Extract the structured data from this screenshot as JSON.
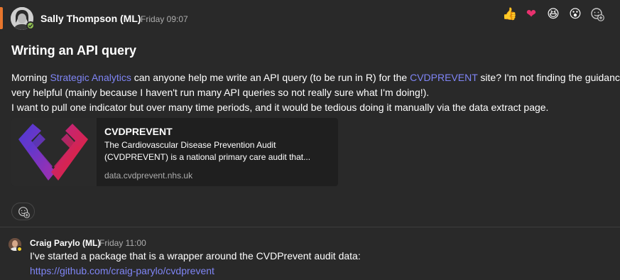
{
  "post": {
    "author": "Sally Thompson (ML)",
    "time": "Friday 09:07",
    "title": "Writing an API query",
    "body": {
      "greeting": "Morning ",
      "mention": "Strategic Analytics",
      "part1": " can anyone help me write an API query (to be run in R) for the ",
      "link": "CVDPREVENT",
      "part2": " site? I'm not finding the guidance",
      "line2": "very helpful (mainly because I haven't run many API queries so not really sure what I'm doing!).",
      "line3": "I want to pull one indicator but over many time periods, and it would be tedious doing it manually via the data extract page."
    },
    "reactions": [
      "👍",
      "❤",
      "😆",
      "😮"
    ],
    "link_card": {
      "title": "CVDPREVENT",
      "description": "The Cardiovascular Disease Prevention Audit (CVDPREVENT) is a national primary care audit that...",
      "domain": "data.cvdprevent.nhs.uk"
    }
  },
  "reply": {
    "author": "Craig Parylo (ML)",
    "time": "Friday 11:00",
    "text": "I've started a package that is a wrapper around the CVDPrevent audit data:",
    "link": "https://github.com/craig-parylo/cvdprevent"
  },
  "colors": {
    "background": "#292929",
    "accent": "#e8762d",
    "mention": "#7f85f5",
    "card_background": "#1f1f1f",
    "status_available": "#92c353",
    "status_away": "#f8d22a"
  }
}
